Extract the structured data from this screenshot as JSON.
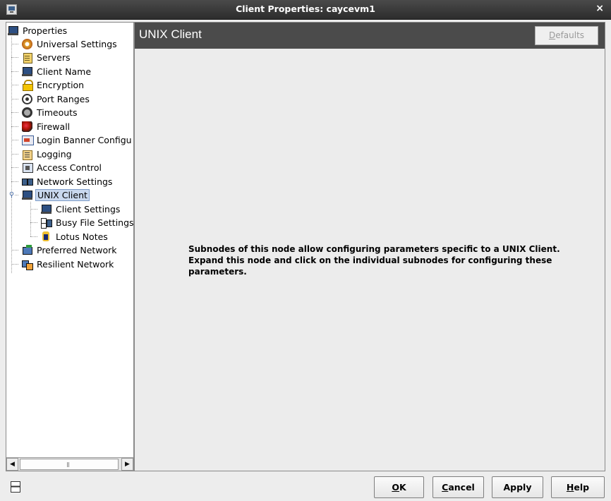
{
  "window": {
    "title": "Client Properties: caycevm1",
    "close_glyph": "×"
  },
  "tree": {
    "root": {
      "label": "Properties",
      "icon": "computer-icon"
    },
    "items": [
      {
        "label": "Universal Settings",
        "icon": "gear-icon"
      },
      {
        "label": "Servers",
        "icon": "server-icon"
      },
      {
        "label": "Client Name",
        "icon": "computer-icon"
      },
      {
        "label": "Encryption",
        "icon": "lock-icon"
      },
      {
        "label": "Port Ranges",
        "icon": "target-icon"
      },
      {
        "label": "Timeouts",
        "icon": "clock-icon"
      },
      {
        "label": "Firewall",
        "icon": "firewall-icon"
      },
      {
        "label": "Login Banner Configu",
        "icon": "banner-icon"
      },
      {
        "label": "Logging",
        "icon": "logging-icon"
      },
      {
        "label": "Access Control",
        "icon": "access-control-icon"
      },
      {
        "label": "Network Settings",
        "icon": "network-icon"
      },
      {
        "label": "UNIX Client",
        "icon": "computer-icon",
        "selected": true,
        "expanded": true
      },
      {
        "label": "Preferred Network",
        "icon": "preferred-network-icon"
      },
      {
        "label": "Resilient Network",
        "icon": "resilient-network-icon"
      }
    ],
    "unix_children": [
      {
        "label": "Client Settings",
        "icon": "computer-icon"
      },
      {
        "label": "Busy File Settings",
        "icon": "hourglass-icon"
      },
      {
        "label": "Lotus Notes",
        "icon": "lotus-notes-icon"
      }
    ]
  },
  "panel": {
    "title": "UNIX Client",
    "defaults_label": {
      "mnemonic": "D",
      "rest": "efaults"
    },
    "description": "Subnodes of this node allow configuring parameters specific to a UNIX Client. Expand this node and click on the individual subnodes for configuring these parameters."
  },
  "buttons": {
    "ok": {
      "mnemonic": "O",
      "rest": "K"
    },
    "cancel": {
      "mnemonic": "C",
      "rest": "ancel"
    },
    "apply": {
      "label": "Apply"
    },
    "help": {
      "mnemonic": "H",
      "rest": "elp"
    }
  }
}
